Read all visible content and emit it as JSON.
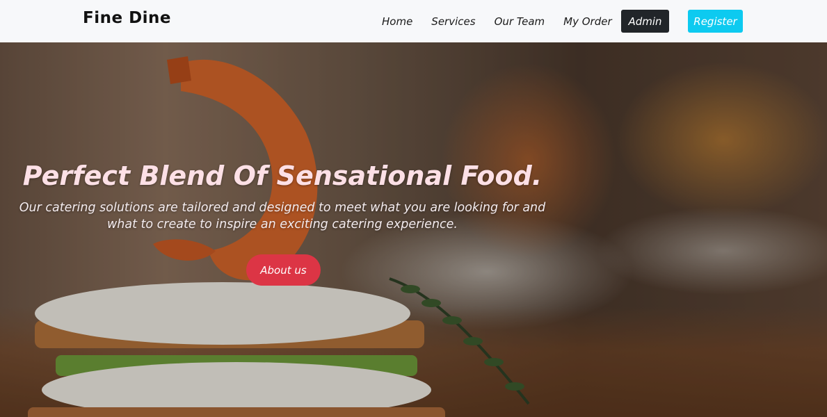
{
  "brand": {
    "name": "Fine Dine"
  },
  "nav": {
    "links": [
      {
        "label": "Home"
      },
      {
        "label": "Services"
      },
      {
        "label": "Our Team"
      },
      {
        "label": "My Order"
      }
    ],
    "admin_label": "Admin",
    "register_label": "Register"
  },
  "hero": {
    "title": "Perfect Blend Of Sensational Food.",
    "subtitle": "Our catering solutions are tailored and designed to meet what you are looking for and what to create to inspire an exciting catering experience.",
    "cta_label": "About us"
  },
  "colors": {
    "navbar_bg": "#f7f8fa",
    "admin_bg": "#212529",
    "register_bg": "#0dcaf0",
    "cta_bg": "#dc3545",
    "title_color": "#fde0e6"
  }
}
